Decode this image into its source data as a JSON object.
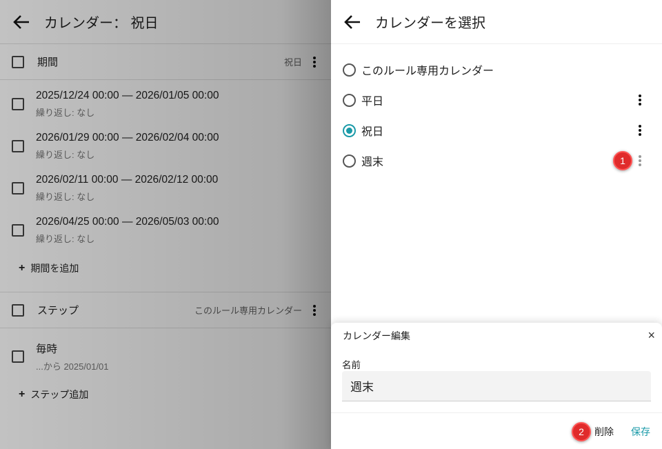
{
  "left": {
    "title": "カレンダー： 祝日",
    "period_section": {
      "label": "期間",
      "sub": "祝日"
    },
    "periods": [
      {
        "range": "2025/12/24 00:00 — 2026/01/05 00:00",
        "repeat": "繰り返し: なし"
      },
      {
        "range": "2026/01/29 00:00 — 2026/02/04 00:00",
        "repeat": "繰り返し: なし"
      },
      {
        "range": "2026/02/11 00:00 — 2026/02/12 00:00",
        "repeat": "繰り返し: なし"
      },
      {
        "range": "2026/04/25 00:00 — 2026/05/03 00:00",
        "repeat": "繰り返し: なし"
      }
    ],
    "add_period": "期間を追加",
    "step_section": {
      "label": "ステップ",
      "sub": "このルール専用カレンダー"
    },
    "steps": [
      {
        "title": "毎時",
        "sub": "...から 2025/01/01"
      }
    ],
    "add_step": "ステップ追加"
  },
  "right": {
    "title": "カレンダーを選択",
    "options": [
      {
        "label": "このルール専用カレンダー",
        "selected": false
      },
      {
        "label": "平日",
        "selected": false
      },
      {
        "label": "祝日",
        "selected": true
      },
      {
        "label": "週末",
        "selected": false
      }
    ]
  },
  "sheet": {
    "title": "カレンダー編集",
    "name_label": "名前",
    "name_value": "週末",
    "delete": "削除",
    "save": "保存",
    "close": "×"
  },
  "badges": [
    "1",
    "2"
  ],
  "colors": {
    "accent": "#1a9aa8",
    "badge": "#e02b2b"
  }
}
